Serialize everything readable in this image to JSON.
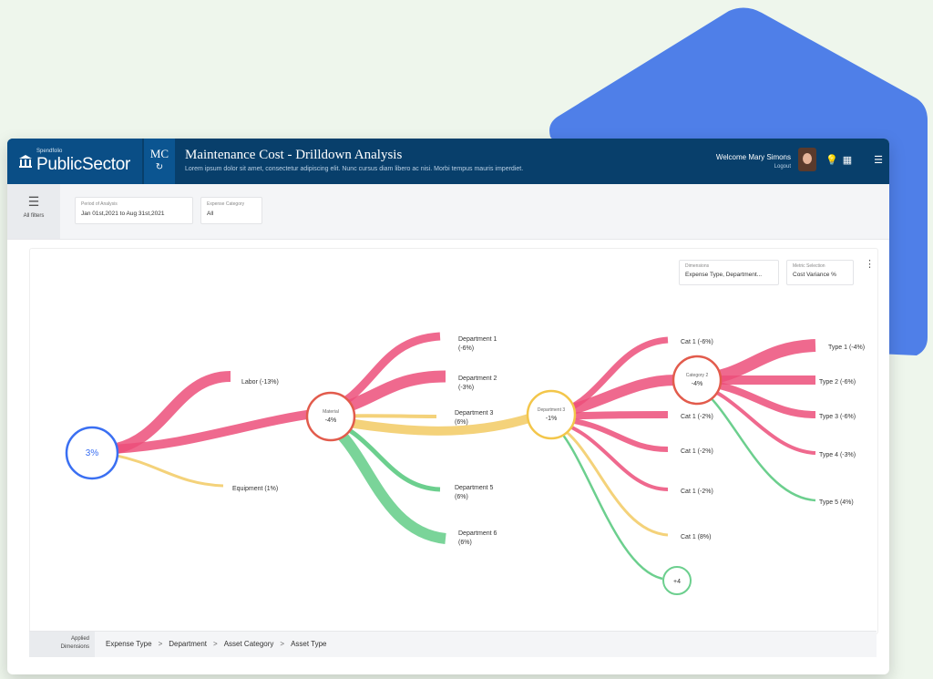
{
  "brand": {
    "small": "Spendfolio",
    "name": "PublicSector"
  },
  "module": {
    "code": "MC"
  },
  "header": {
    "title": "Maintenance Cost - Drilldown Analysis",
    "subtitle": "Lorem ipsum dolor sit amet, consectetur adipiscing elit. Nunc cursus diam libero ac nisi. Morbi tempus mauris imperdiet.",
    "welcome": "Welcome Mary Simons",
    "logout": "Logout"
  },
  "filters": {
    "label": "All filters",
    "period": {
      "label": "Period of Analysis",
      "value": "Jan 01st,2021 to Aug 31st,2021"
    },
    "expense": {
      "label": "Expense Category",
      "value": "All"
    }
  },
  "controls": {
    "dimension": {
      "label": "Dimensions",
      "value": "Expense Type, Department..."
    },
    "metric": {
      "label": "Metric Selection",
      "value": "Cost Variance %"
    }
  },
  "tree": {
    "root": {
      "label": "3%"
    },
    "labor": "Labor (-13%)",
    "equipment": "Equipment (1%)",
    "material": {
      "line1": "Material",
      "line2": "-4%"
    },
    "departments": [
      {
        "line1": "Department 1",
        "line2": "(-6%)"
      },
      {
        "line1": "Department 2",
        "line2": "(-3%)"
      },
      {
        "line1": "Department 3",
        "line2": "(6%)"
      },
      {
        "line1": "Department 5",
        "line2": "(6%)"
      },
      {
        "line1": "Department 6",
        "line2": "(6%)"
      }
    ],
    "dept3node": {
      "line1": "Department 3",
      "line2": "-1%"
    },
    "categories": [
      "Cat 1 (-6%)",
      "Cat 1 (-2%)",
      "Cat 1 (-2%)",
      "Cat 1 (-2%)",
      "Cat 1 (8%)"
    ],
    "category2": {
      "line1": "Category 2",
      "line2": "-4%"
    },
    "more": "+4",
    "types": [
      "Type 1 (-4%)",
      "Type 2 (-6%)",
      "Type 3 (-6%)",
      "Type 4 (-3%)",
      "Type 5 (4%)"
    ]
  },
  "footer": {
    "applied_label1": "Applied",
    "applied_label2": "Dimensions",
    "crumbs": [
      "Expense Type",
      "Department",
      "Asset Category",
      "Asset Type"
    ]
  },
  "colors": {
    "header": "#083f6b",
    "red": "#ec4f7a",
    "yellow": "#f4d27a",
    "green": "#6ccf8e",
    "blue": "#3a6ff2",
    "shape": "#4f7fe8"
  }
}
